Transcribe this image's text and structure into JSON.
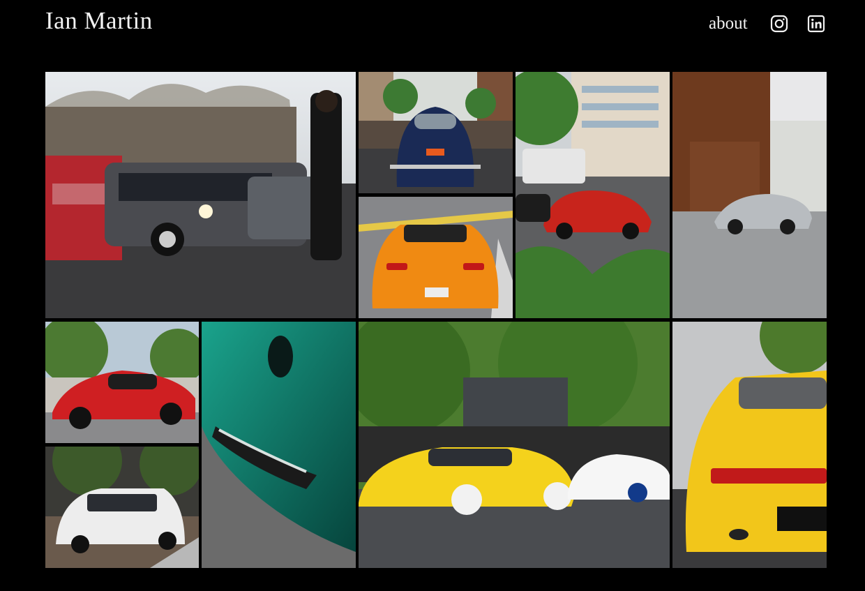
{
  "site": {
    "title": "Ian Martin"
  },
  "nav": {
    "about_label": "about",
    "icons": [
      "instagram-icon",
      "linkedin-icon"
    ]
  },
  "gallery": {
    "photos": [
      {
        "name": "photo-bmw-e30-group"
      },
      {
        "name": "photo-blue-vw-beetle"
      },
      {
        "name": "photo-orange-porsche-boxster"
      },
      {
        "name": "photo-red-ferrari-street"
      },
      {
        "name": "photo-silver-porsche-911-garage"
      },
      {
        "name": "photo-red-ferrari-458"
      },
      {
        "name": "photo-teal-alfa-romeo-closeup"
      },
      {
        "name": "photo-white-ford-escort"
      },
      {
        "name": "photo-yellow-porsche-964-crowd"
      },
      {
        "name": "photo-yellow-porsche-993-rear"
      }
    ]
  },
  "colors": {
    "background": "#000000",
    "text": "#f2f2f2"
  }
}
